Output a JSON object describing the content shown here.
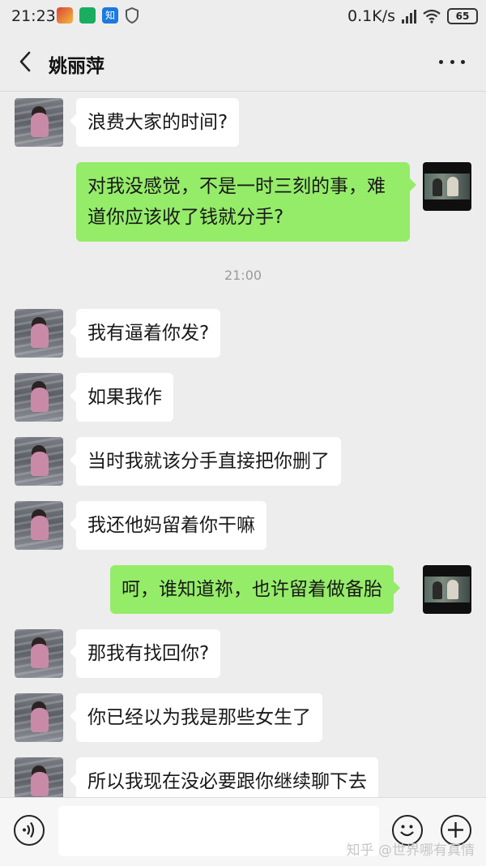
{
  "status_bar": {
    "time": "21:23",
    "network_speed": "0.1K/s",
    "battery": "65",
    "app_icons": [
      "game-app-icon",
      "news-app-icon",
      "zhihu-app-icon"
    ],
    "zhihu_glyph": "知"
  },
  "header": {
    "title": "姚丽萍"
  },
  "chat": {
    "messages": [
      {
        "side": "left",
        "text": "浪费大家的时间?"
      },
      {
        "side": "right",
        "text": "对我没感觉，不是一时三刻的事，难道你应该收了钱就分手?"
      },
      {
        "side": "timestamp",
        "text": "21:00"
      },
      {
        "side": "left",
        "text": "我有逼着你发?"
      },
      {
        "side": "left",
        "text": "如果我作"
      },
      {
        "side": "left",
        "text": "当时我就该分手直接把你删了"
      },
      {
        "side": "left",
        "text": "我还他妈留着你干嘛"
      },
      {
        "side": "right",
        "text": "呵，谁知道祢，也许留着做备胎"
      },
      {
        "side": "left",
        "text": "那我有找回你?"
      },
      {
        "side": "left",
        "text": "你已经以为我是那些女生了"
      },
      {
        "side": "left",
        "text": "所以我现在没必要跟你继续聊下去"
      }
    ]
  },
  "input_bar": {
    "watermark": "知乎 @世界哪有真情"
  },
  "colors": {
    "background": "#ededed",
    "bubble_right": "#95ec69",
    "bubble_left": "#ffffff"
  }
}
